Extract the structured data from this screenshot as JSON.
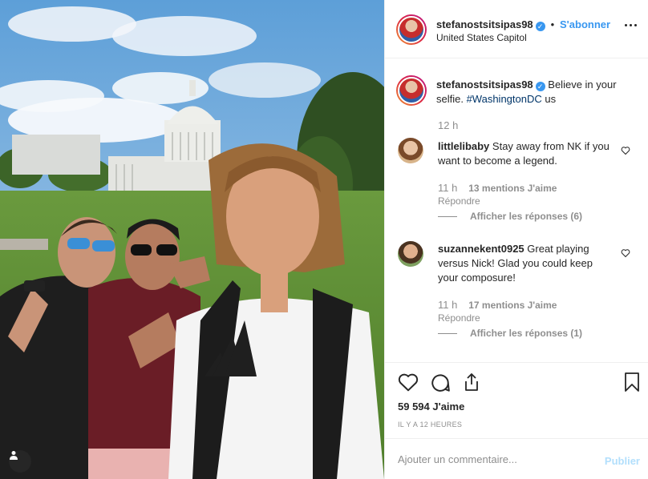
{
  "post": {
    "username": "stefanostsitsipas98",
    "verified_icon": "verified-badge-icon",
    "separator": "•",
    "follow_label": "S'abonner",
    "location": "United States Capitol",
    "more_icon": "more-options-icon"
  },
  "caption": {
    "username": "stefanostsitsipas98",
    "text_before": " Believe in your selfie. ",
    "hashtag": "#WashingtonDC",
    "text_after": " us",
    "age": "12 h"
  },
  "comments": [
    {
      "username": "littlelibaby",
      "text": " Stay away from NK if you want to become a legend.",
      "age": "11 h",
      "likes": "13 mentions J'aime",
      "reply_label": "Répondre",
      "view_replies": "Afficher les réponses (6)"
    },
    {
      "username": "suzannekent0925",
      "text": " Great playing versus Nick! Glad you could keep your composure!",
      "age": "11 h",
      "likes": "17 mentions J'aime",
      "reply_label": "Répondre",
      "view_replies": "Afficher les réponses (1)"
    }
  ],
  "actions": {
    "like_icon": "heart-icon",
    "comment_icon": "comment-icon",
    "share_icon": "share-icon",
    "save_icon": "bookmark-icon",
    "likes_count": "59 594 J'aime",
    "time_ago": "Il y a 12 heures"
  },
  "add_comment": {
    "placeholder": "Ajouter un commentaire...",
    "publish_label": "Publier"
  },
  "colors": {
    "accent": "#3897f0",
    "publish_disabled": "#b2dffc",
    "muted": "#8e8e8e",
    "text": "#262626"
  }
}
